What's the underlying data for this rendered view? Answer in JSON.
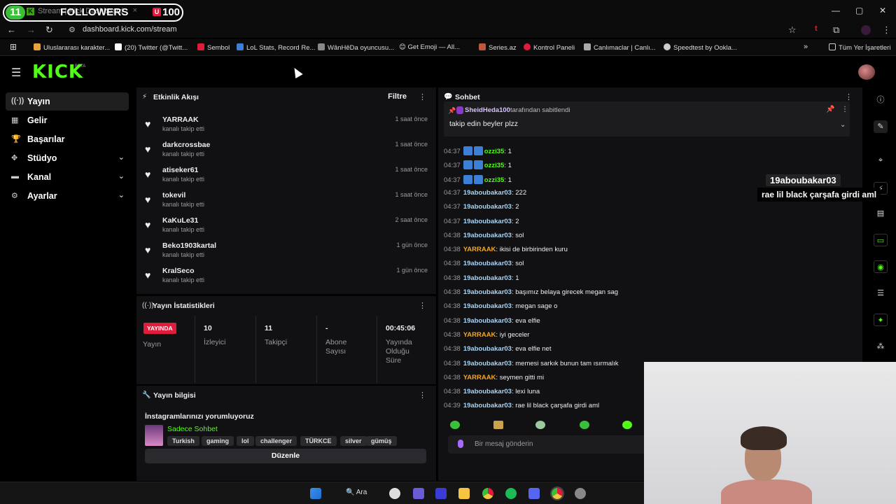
{
  "browser": {
    "tab_title": "Stream | Kick Dashboard",
    "tab_close": "×",
    "url": "dashboard.kick.com/stream",
    "win_minimize": "—",
    "win_restore": "▢",
    "win_close": "✕",
    "bookmarks": [
      {
        "label": "Uluslararası karakter...",
        "color": "#e8a33c"
      },
      {
        "label": "(20) Twitter (@Twitt...",
        "color": "#ffffff"
      },
      {
        "label": "Sembol",
        "color": "#e01b3c"
      },
      {
        "label": "LoL Stats, Record Re...",
        "color": "#3b7fd6"
      },
      {
        "label": "WânHêDa oyuncusu...",
        "color": "#888888"
      },
      {
        "label": "😊 Get Emoji — All...",
        "color": "#f5c542"
      },
      {
        "label": "Series.az",
        "color": "#c0563b"
      },
      {
        "label": "Kontrol Paneli",
        "color": "#e01b3c"
      },
      {
        "label": "Canlımaclar | Canlı...",
        "color": "#aaaaaa"
      },
      {
        "label": "Speedtest by Ookla...",
        "color": "#cccccc"
      }
    ],
    "bookmarks_more": "»",
    "all_bookmarks": "Tüm Yer İşaretleri"
  },
  "overlay": {
    "count_left": "11",
    "label": "FOLLOWERS",
    "badge": "U",
    "count_right": "100",
    "chat_user": "19aboubakar03",
    "chat_msg": "rae lil black çarşafa girdi aml"
  },
  "header": {
    "logo": "KICK",
    "beta": "BETA"
  },
  "sidebar": {
    "items": [
      {
        "label": "Yayın",
        "icon": "((·))",
        "active": true,
        "chevron": ""
      },
      {
        "label": "Gelir",
        "icon": "▦",
        "active": false,
        "chevron": ""
      },
      {
        "label": "Başarılar",
        "icon": "🏆",
        "active": false,
        "chevron": ""
      },
      {
        "label": "Stüdyo",
        "icon": "✥",
        "active": false,
        "chevron": "⌄"
      },
      {
        "label": "Kanal",
        "icon": "▬",
        "active": false,
        "chevron": "⌄"
      },
      {
        "label": "Ayarlar",
        "icon": "⚙",
        "active": false,
        "chevron": "⌄"
      }
    ]
  },
  "activity": {
    "title": "Etkinlik Akışı",
    "filter": "Filtre",
    "rows": [
      {
        "name": "YARRAAK",
        "desc": "kanalı takip etti",
        "time": "1 saat önce"
      },
      {
        "name": "darkcrossbae",
        "desc": "kanalı takip etti",
        "time": "1 saat önce"
      },
      {
        "name": "atiseker61",
        "desc": "kanalı takip etti",
        "time": "1 saat önce"
      },
      {
        "name": "tokevil",
        "desc": "kanalı takip etti",
        "time": "1 saat önce"
      },
      {
        "name": "KaKuLe31",
        "desc": "kanalı takip etti",
        "time": "2 saat önce"
      },
      {
        "name": "Beko1903kartal",
        "desc": "kanalı takip etti",
        "time": "1 gün önce"
      },
      {
        "name": "KralSeco",
        "desc": "kanalı takip etti",
        "time": "1 gün önce"
      }
    ]
  },
  "stats": {
    "title": "Yayın İstatistikleri",
    "live_badge": "YAYINDA",
    "live_label": "Yayın",
    "cells": [
      {
        "value": "10",
        "label": "İzleyici"
      },
      {
        "value": "11",
        "label": "Takipçi"
      },
      {
        "value": "-",
        "label": "Abone Sayısı"
      },
      {
        "value": "00:45:06",
        "label": "Yayında Olduğu Süre"
      }
    ]
  },
  "info": {
    "title": "Yayın bilgisi",
    "stream_title": "İnstagramlarınızı yorumluyoruz",
    "category": "Sadece Sohbet",
    "tags": [
      "Turkish",
      "gaming",
      "lol",
      "challenger",
      "TÜRKCE",
      "silver",
      "gümüş"
    ],
    "edit_button": "Düzenle"
  },
  "chat": {
    "title": "Sohbet",
    "pinned_user": "SheidHeda100",
    "pinned_by": "tarafından sabitlendi",
    "pinned_text": "takip edin beyler plzz",
    "messages": [
      {
        "time": "04:37",
        "badge": true,
        "user": "ozzi35",
        "color": "#53fc18",
        "text": "1"
      },
      {
        "time": "04:37",
        "badge": true,
        "user": "ozzi35",
        "color": "#53fc18",
        "text": "1"
      },
      {
        "time": "04:37",
        "badge": true,
        "user": "ozzi35",
        "color": "#53fc18",
        "text": "1"
      },
      {
        "time": "04:37",
        "badge": false,
        "user": "19aboubakar03",
        "color": "#a8d4f5",
        "text": "222"
      },
      {
        "time": "04:37",
        "badge": false,
        "user": "19aboubakar03",
        "color": "#a8d4f5",
        "text": "2"
      },
      {
        "time": "04:37",
        "badge": false,
        "user": "19aboubakar03",
        "color": "#a8d4f5",
        "text": "2"
      },
      {
        "time": "04:38",
        "badge": false,
        "user": "19aboubakar03",
        "color": "#a8d4f5",
        "text": "sol"
      },
      {
        "time": "04:38",
        "badge": false,
        "user": "YARRAAK",
        "color": "#f5a623",
        "text": "ikisi de birbirinden kuru"
      },
      {
        "time": "04:38",
        "badge": false,
        "user": "19aboubakar03",
        "color": "#a8d4f5",
        "text": "sol"
      },
      {
        "time": "04:38",
        "badge": false,
        "user": "19aboubakar03",
        "color": "#a8d4f5",
        "text": "1"
      },
      {
        "time": "04:38",
        "badge": false,
        "user": "19aboubakar03",
        "color": "#a8d4f5",
        "text": "başımız belaya girecek megan sag"
      },
      {
        "time": "04:38",
        "badge": false,
        "user": "19aboubakar03",
        "color": "#a8d4f5",
        "text": "megan sage o"
      },
      {
        "time": "04:38",
        "badge": false,
        "user": "19aboubakar03",
        "color": "#a8d4f5",
        "text": "eva elfie"
      },
      {
        "time": "04:38",
        "badge": false,
        "user": "YARRAAK",
        "color": "#f5a623",
        "text": "iyi geceler"
      },
      {
        "time": "04:38",
        "badge": false,
        "user": "19aboubakar03",
        "color": "#a8d4f5",
        "text": "eva elfie net"
      },
      {
        "time": "04:38",
        "badge": false,
        "user": "19aboubakar03",
        "color": "#a8d4f5",
        "text": "memesi sarkık bunun tam ısırmalık"
      },
      {
        "time": "04:38",
        "badge": false,
        "user": "YARRAAK",
        "color": "#f5a623",
        "text": "seymen gitti mi"
      },
      {
        "time": "04:38",
        "badge": false,
        "user": "19aboubakar03",
        "color": "#a8d4f5",
        "text": "lexi luna"
      },
      {
        "time": "04:39",
        "badge": false,
        "user": "19aboubakar03",
        "color": "#a8d4f5",
        "text": "rae lil black çarşafa girdi aml"
      }
    ],
    "input_placeholder": "Bir mesaj gönderin"
  },
  "taskbar": {
    "search_label": "Ara"
  }
}
